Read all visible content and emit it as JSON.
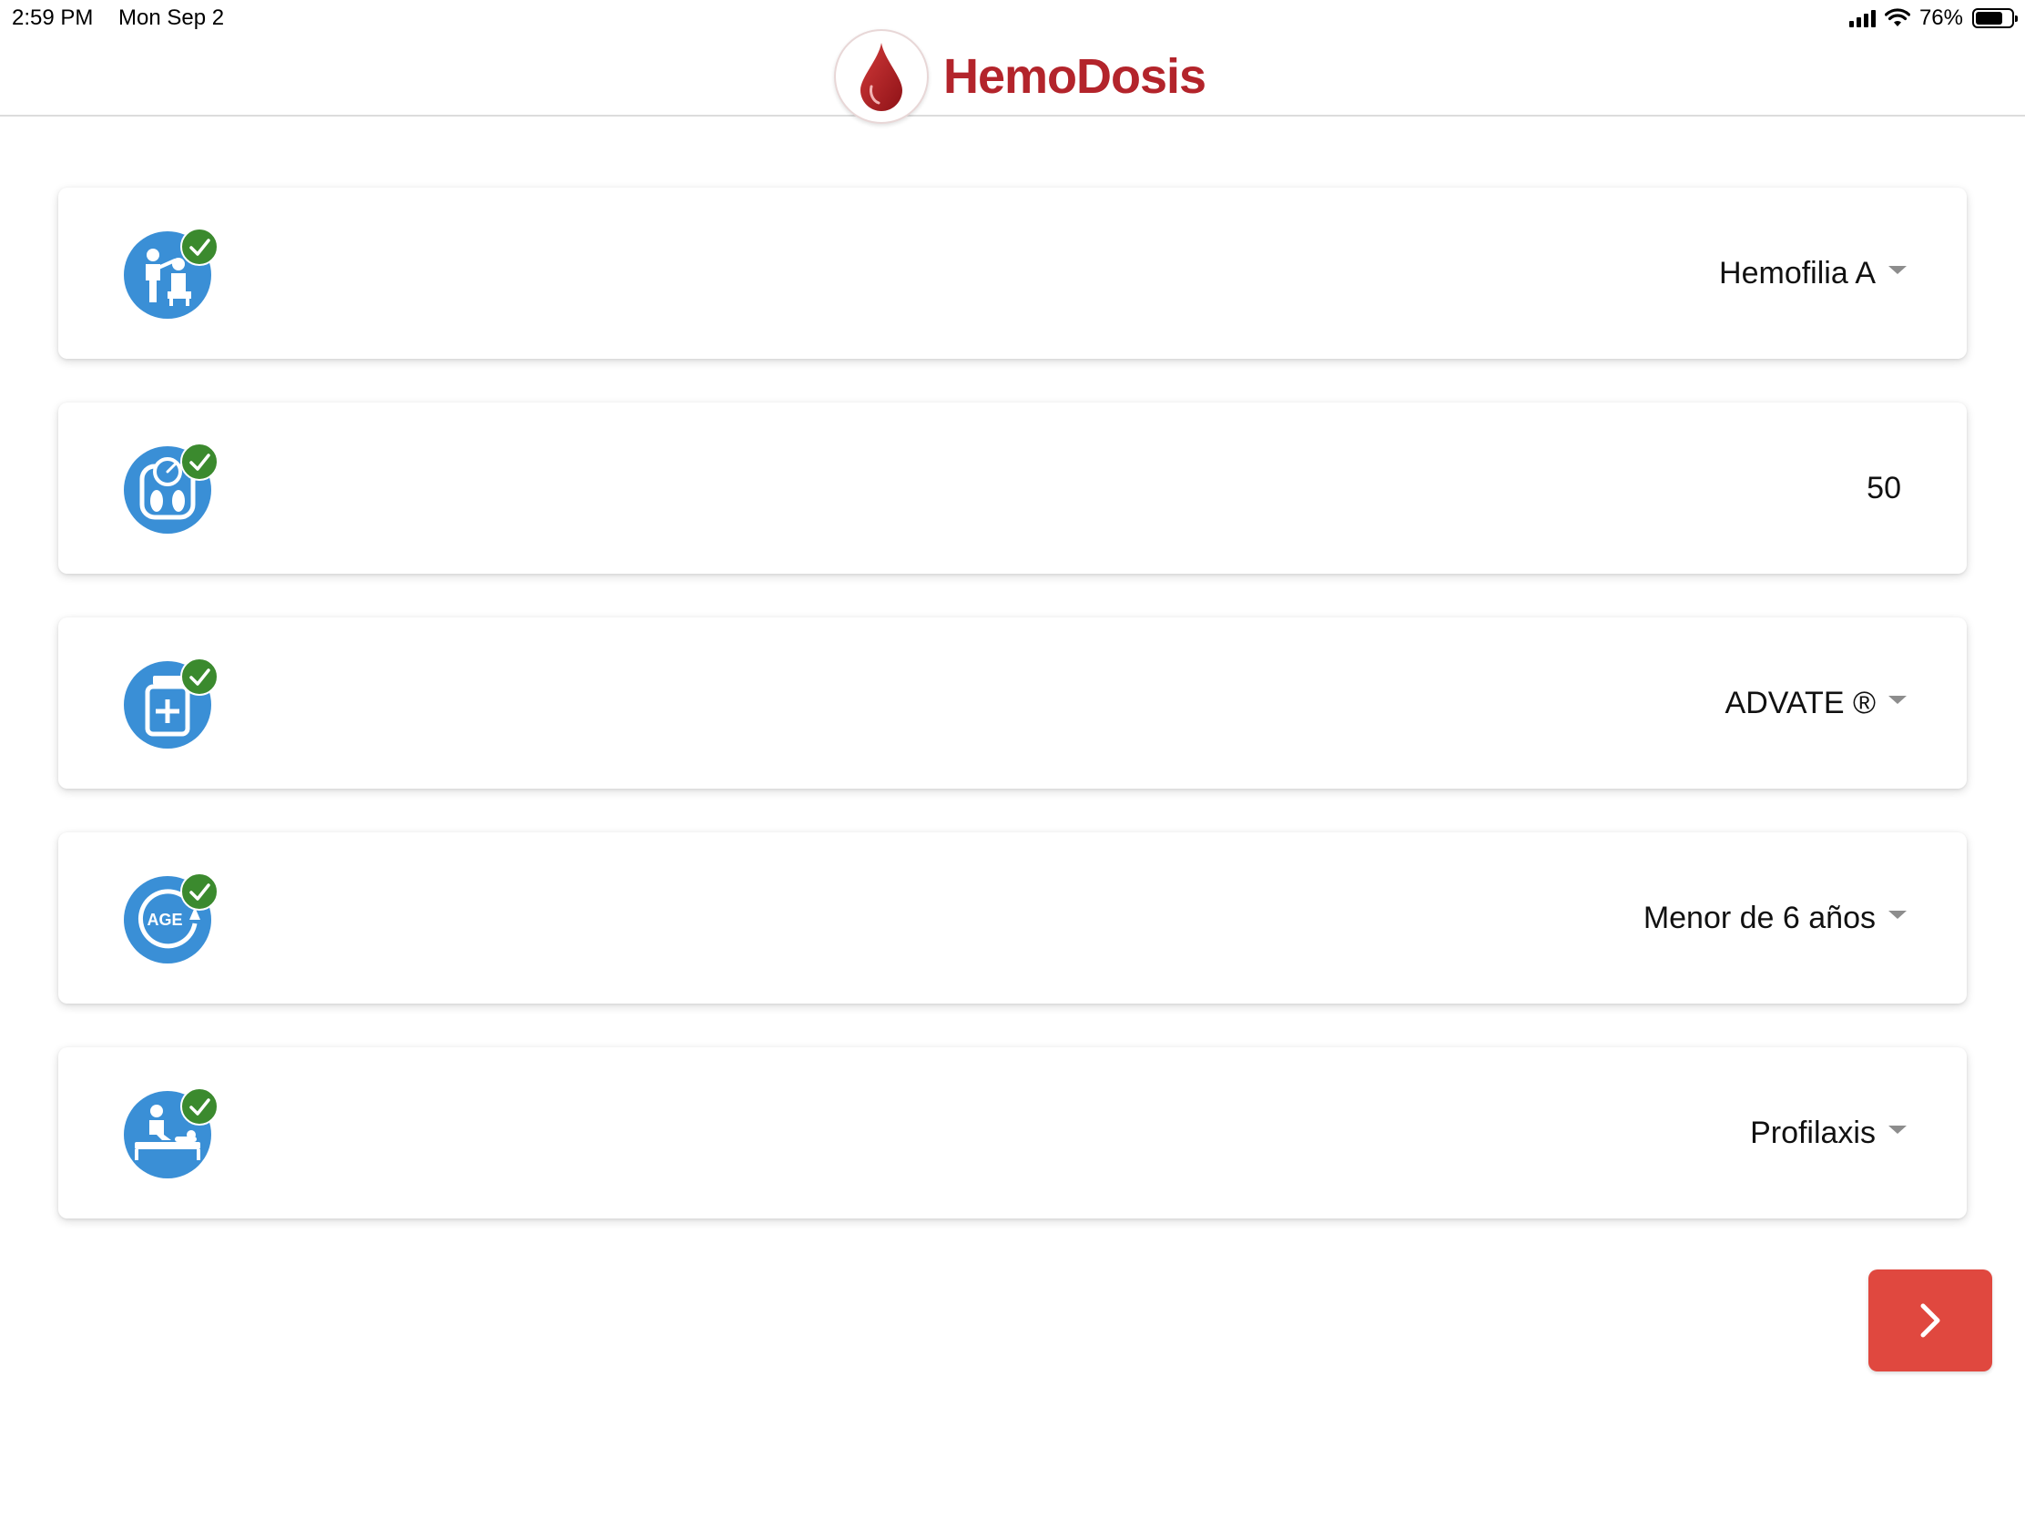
{
  "status_bar": {
    "time": "2:59 PM",
    "date": "Mon Sep 2",
    "battery_percent_label": "76%",
    "battery_level": 0.76
  },
  "header": {
    "app_name": "HemoDosis",
    "brand_color": "#b3242b"
  },
  "fields": [
    {
      "icon": "patient-consultation-icon",
      "value": "Hemofilia A",
      "has_dropdown": true
    },
    {
      "icon": "weight-scale-icon",
      "value": "50",
      "has_dropdown": false
    },
    {
      "icon": "medicine-bottle-icon",
      "value": "ADVATE ®",
      "has_dropdown": true
    },
    {
      "icon": "age-icon",
      "value": "Menor de 6 años",
      "has_dropdown": true,
      "icon_text": "AGE"
    },
    {
      "icon": "treatment-icon",
      "value": "Profilaxis",
      "has_dropdown": true
    }
  ],
  "colors": {
    "icon_blue": "#3a8fd6",
    "check_green": "#3b8a2e",
    "next_button": "#e0483f"
  },
  "next_button": {
    "icon": "chevron-right-icon"
  }
}
